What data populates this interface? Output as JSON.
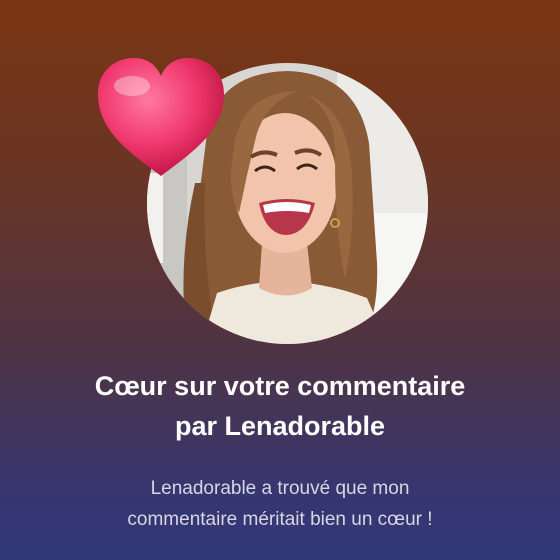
{
  "notification": {
    "title_line1": "Cœur sur votre commentaire",
    "title_line2": "par Lenadorable",
    "description_line1": "Lenadorable a trouvé que mon",
    "description_line2": "commentaire méritait bien un cœur !",
    "avatar_alt": "Lenadorable"
  },
  "colors": {
    "background_top": "#7a3512",
    "background_bottom": "#313878",
    "heart": "#f0386d",
    "title_text": "#ffffff",
    "description_text": "#d8d6e2"
  }
}
